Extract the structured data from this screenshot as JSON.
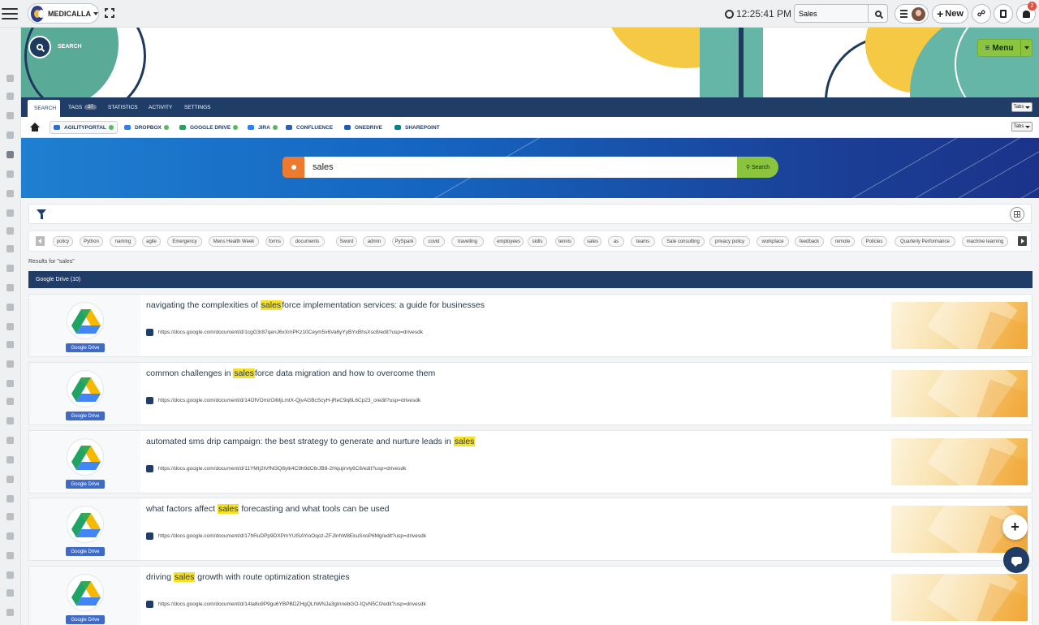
{
  "header": {
    "brand": "MEDICALLA",
    "clock": "12:25:41 PM",
    "search_value": "Sales",
    "new_label": "New",
    "notification_count": "2"
  },
  "banner": {
    "search_label": "SEARCH",
    "menu_label": "Menu"
  },
  "tabs": [
    {
      "label": "SEARCH"
    },
    {
      "label": "TAGS",
      "count": "37"
    },
    {
      "label": "STATISTICS"
    },
    {
      "label": "ACTIVITY"
    },
    {
      "label": "SETTINGS"
    }
  ],
  "tabs_select": "Tabs",
  "sources": [
    {
      "label": "AGILITYPORTAL",
      "color": "#2c6fd1"
    },
    {
      "label": "DROPBOX",
      "color": "#2f80ed"
    },
    {
      "label": "GOOGLE DRIVE",
      "color": "#1fa463"
    },
    {
      "label": "JIRA",
      "color": "#2684ff"
    },
    {
      "label": "CONFLUENCE",
      "color": "#2d5fb8"
    },
    {
      "label": "ONEDRIVE",
      "color": "#1e5bb5"
    },
    {
      "label": "SHAREPOINT",
      "color": "#038387"
    }
  ],
  "search": {
    "query": "sales",
    "button": "Search"
  },
  "tags": [
    "policy",
    "Python",
    "naming",
    "agile",
    "Emergency",
    "Mens Health Week",
    "forms",
    "documents",
    "Sword",
    "admin",
    "PySpark",
    "covid",
    "travelling",
    "employees",
    "skills",
    "tennis",
    "sales",
    "as",
    "teams",
    "Sale consulting",
    "privacy policy",
    "workplace",
    "feedback",
    "remote",
    "Policies",
    "Quarterly Performance",
    "machine learning"
  ],
  "results_text": "Results for \"sales\"",
  "group_header": "Google Drive (10)",
  "source_label": "Google Drive",
  "results": [
    {
      "pre": "navigating the complexities of ",
      "hl": "sales",
      "post": "force implementation services: a guide for businesses",
      "url": "https://docs.google.com/document/d/1cgG3r87qenJ6xXmPKz10Ceym5x6Va6yYyBYxBhsXsc8/edit?usp=drivesdk"
    },
    {
      "pre": "common challenges in ",
      "hl": "sales",
      "post": "force data migration and how to overcome them",
      "url": "https://docs.google.com/document/d/14OfVOmzOiMjLmtX-QjvAGBcScyH-jReC9q8L6Cp23_o/edit?usp=drivesdk"
    },
    {
      "pre": "automated sms drip campaign: the best strategy to generate and nurture leads in ",
      "hl": "sales",
      "post": "",
      "url": "https://docs.google.com/document/d/11YMIj2tVfNl3Q8ylk4C9h9dC6rJB8-2Hqujirvly6C8/edit?usp=drivesdk"
    },
    {
      "pre": "what factors affect ",
      "hl": "sales",
      "post": " forecasting and what tools can be used",
      "url": "https://docs.google.com/document/d/17hRuDPp9DXPmYUlSAYioOqoz-ZFJInhW8EkuSnoP6Mg/edit?usp=drivesdk"
    },
    {
      "pre": "driving ",
      "hl": "sales",
      "post": " growth with route optimization strategies",
      "url": "https://docs.google.com/document/d/14ta8u9P9gu6YBPBDZHgQLhWNJa3gInnebGO-IQvN5C0/edit?usp=drivesdk"
    }
  ]
}
